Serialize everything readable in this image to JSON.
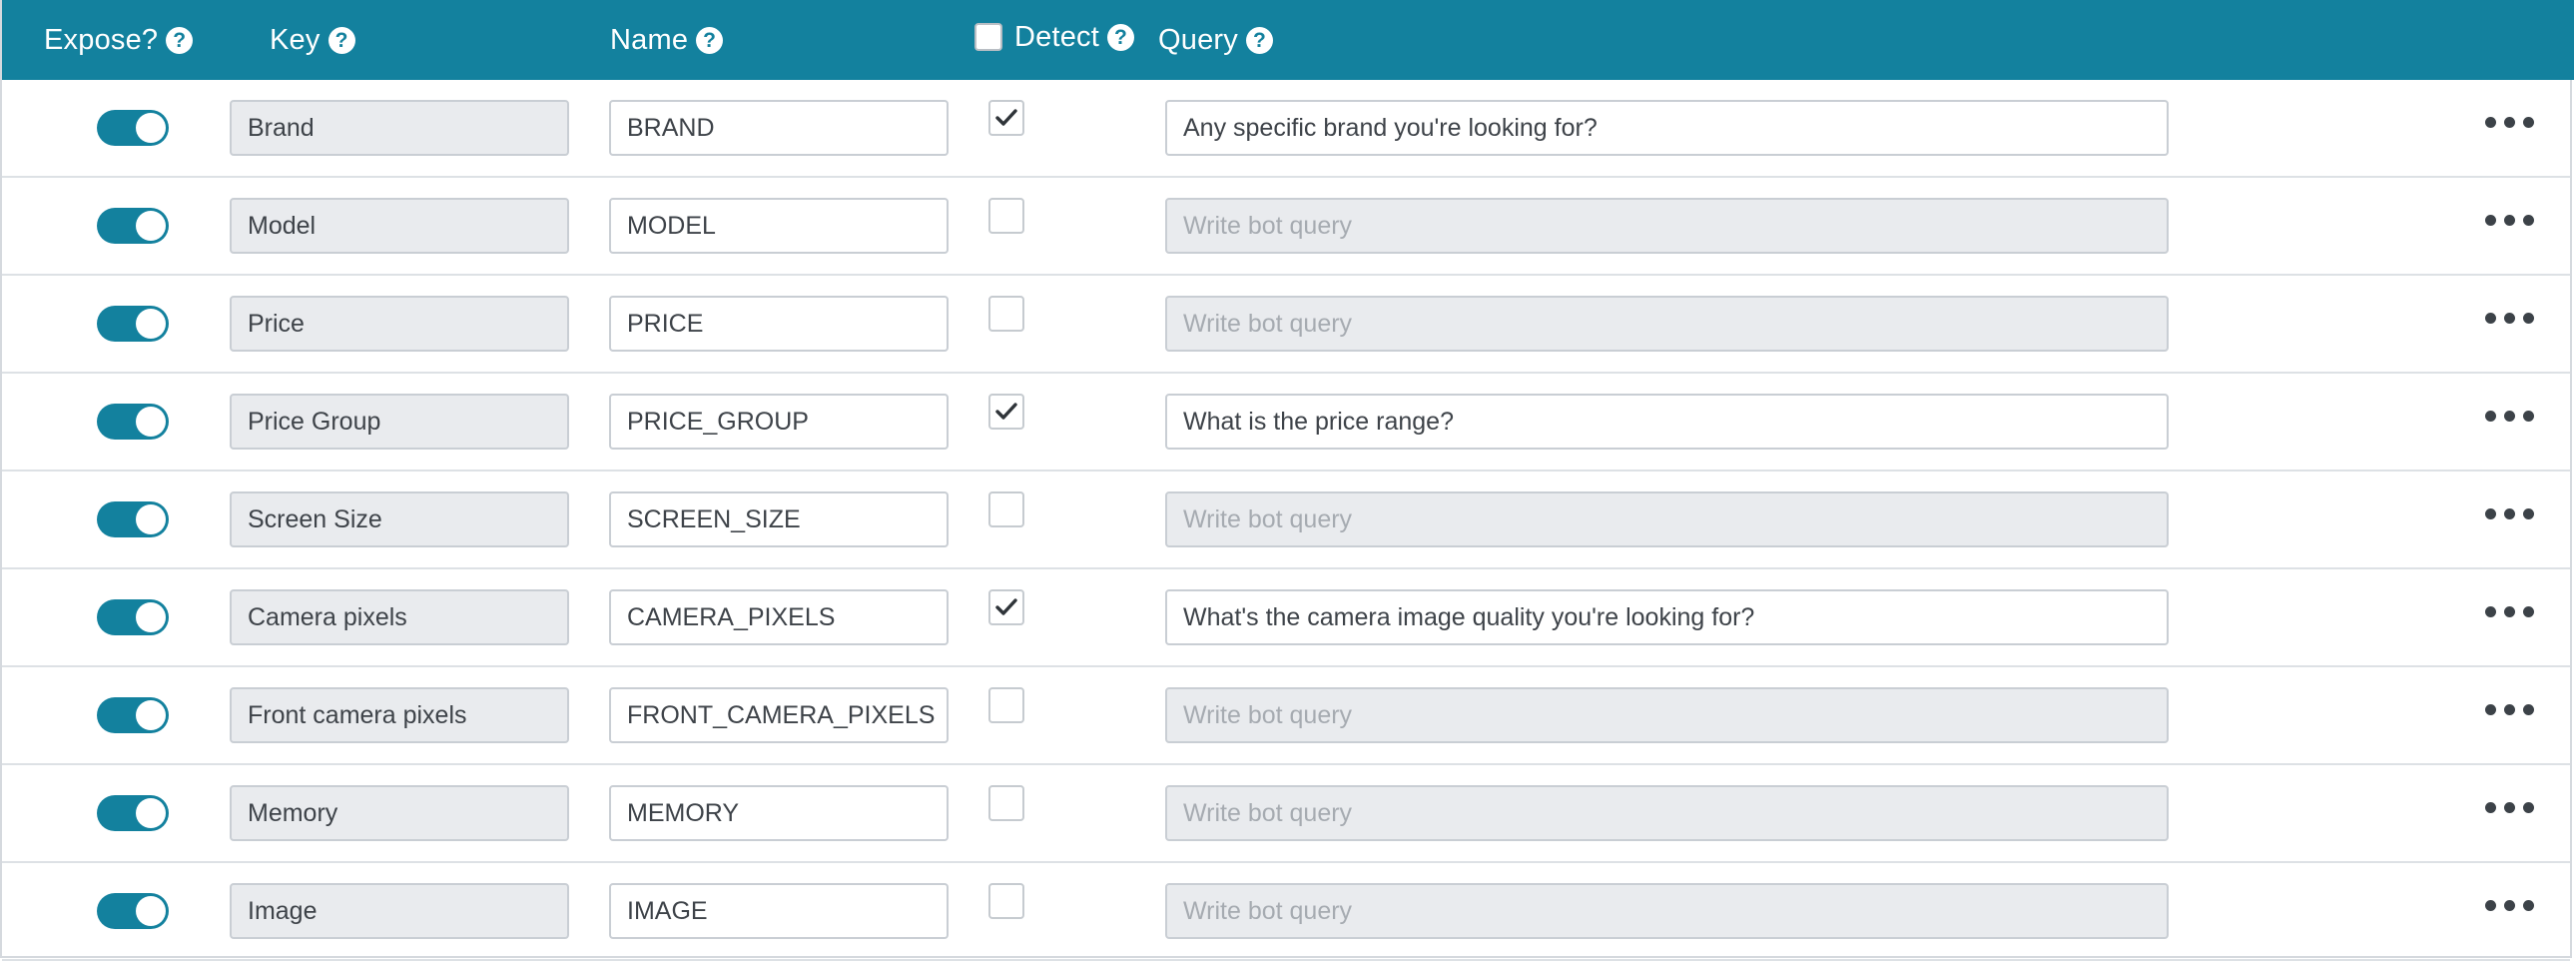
{
  "header": {
    "expose": "Expose?",
    "key": "Key",
    "name": "Name",
    "detect": "Detect",
    "query": "Query"
  },
  "colors": {
    "header_bg": "#13819e",
    "toggle_on": "#13819e",
    "readonly_bg": "#e9ebee"
  },
  "icons": {
    "help": "question-circle-icon",
    "check": "checkmark-icon",
    "more": "ellipsis-horizontal-icon"
  },
  "query_placeholder": "Write bot query",
  "rows": [
    {
      "expose": true,
      "key": "Brand",
      "name": "BRAND",
      "detect": true,
      "query": "Any specific brand you're looking for?"
    },
    {
      "expose": true,
      "key": "Model",
      "name": "MODEL",
      "detect": false,
      "query": ""
    },
    {
      "expose": true,
      "key": "Price",
      "name": "PRICE",
      "detect": false,
      "query": ""
    },
    {
      "expose": true,
      "key": "Price Group",
      "name": "PRICE_GROUP",
      "detect": true,
      "query": "What is the price range?"
    },
    {
      "expose": true,
      "key": "Screen Size",
      "name": "SCREEN_SIZE",
      "detect": false,
      "query": ""
    },
    {
      "expose": true,
      "key": "Camera pixels",
      "name": "CAMERA_PIXELS",
      "detect": true,
      "query": "What's the camera image quality you're looking for?"
    },
    {
      "expose": true,
      "key": "Front camera pixels",
      "name": "FRONT_CAMERA_PIXELS",
      "detect": false,
      "query": ""
    },
    {
      "expose": true,
      "key": "Memory",
      "name": "MEMORY",
      "detect": false,
      "query": ""
    },
    {
      "expose": true,
      "key": "Image",
      "name": "IMAGE",
      "detect": false,
      "query": ""
    }
  ]
}
